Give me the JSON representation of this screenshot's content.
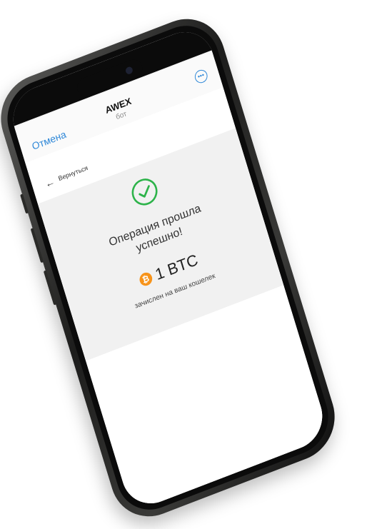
{
  "header": {
    "cancel_label": "Отмена",
    "title": "AWEX",
    "subtitle": "бот",
    "more_icon": "ellipsis-circle-icon"
  },
  "nav": {
    "back_label": "Вернуться",
    "back_icon": "arrow-left-icon"
  },
  "result": {
    "status_line1": "Операция прошла",
    "status_line2": "успешно!",
    "amount": "1 BTC",
    "coin_symbol": "₿",
    "credited_text": "зачислен на ваш кошелек"
  },
  "colors": {
    "accent": "#2f88d8",
    "success": "#2db34a",
    "bitcoin": "#f7931a"
  }
}
